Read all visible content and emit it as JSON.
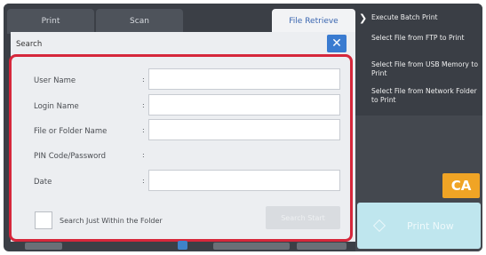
{
  "tabs": [
    {
      "label": "Print"
    },
    {
      "label": "Scan"
    },
    {
      "label": "File Retrieve"
    }
  ],
  "right_panel": {
    "items": [
      {
        "label": "Execute Batch Print"
      },
      {
        "label": "Select File from FTP to Print"
      },
      {
        "label": "Select File from USB Memory to Print"
      },
      {
        "label": "Select File from Network Folder to Print"
      }
    ],
    "ca_label": "CA",
    "print_now_label": "Print Now"
  },
  "dialog": {
    "title": "Search",
    "close_symbol": "✕",
    "fields": [
      {
        "label": "User Name",
        "value": ""
      },
      {
        "label": "Login Name",
        "value": ""
      },
      {
        "label": "File or Folder Name",
        "value": ""
      },
      {
        "label": "PIN Code/Password"
      },
      {
        "label": "Date",
        "value": ""
      }
    ],
    "colon": ":",
    "checkbox_label": "Search Just Within the Folder",
    "search_start_label": "Search Start"
  },
  "colors": {
    "highlight": "#d6273b",
    "close_button": "#3a7bd0",
    "ca_button": "#f0a425",
    "print_now": "#bfe6ee"
  }
}
